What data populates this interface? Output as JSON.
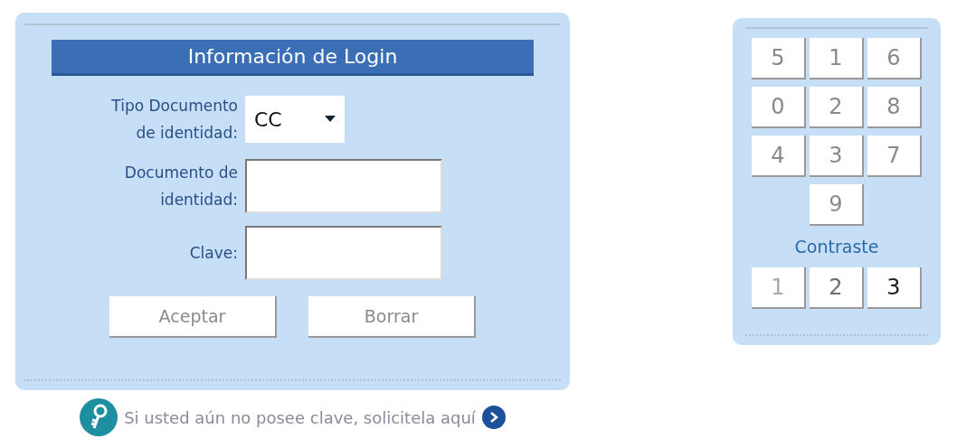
{
  "login": {
    "title": "Información de Login",
    "doc_type": {
      "label": "Tipo Documento de identidad:",
      "value": "CC"
    },
    "doc_number": {
      "label": "Documento de identidad:"
    },
    "password": {
      "label": "Clave:"
    },
    "buttons": [
      "Aceptar",
      "Borrar"
    ]
  },
  "keypad": {
    "keys": [
      [
        "5",
        "1",
        "6"
      ],
      [
        "0",
        "2",
        "8"
      ],
      [
        "4",
        "3",
        "7"
      ],
      [
        "9"
      ]
    ],
    "contrast_label": "Contraste",
    "contrast_options": [
      {
        "label": "1",
        "color": "#a8a8a8"
      },
      {
        "label": "2",
        "color": "#6e6e6e"
      },
      {
        "label": "3",
        "color": "#1e1e1e"
      }
    ]
  },
  "footer": {
    "text": "Si usted aún no posee clave, solicitela aquí"
  }
}
